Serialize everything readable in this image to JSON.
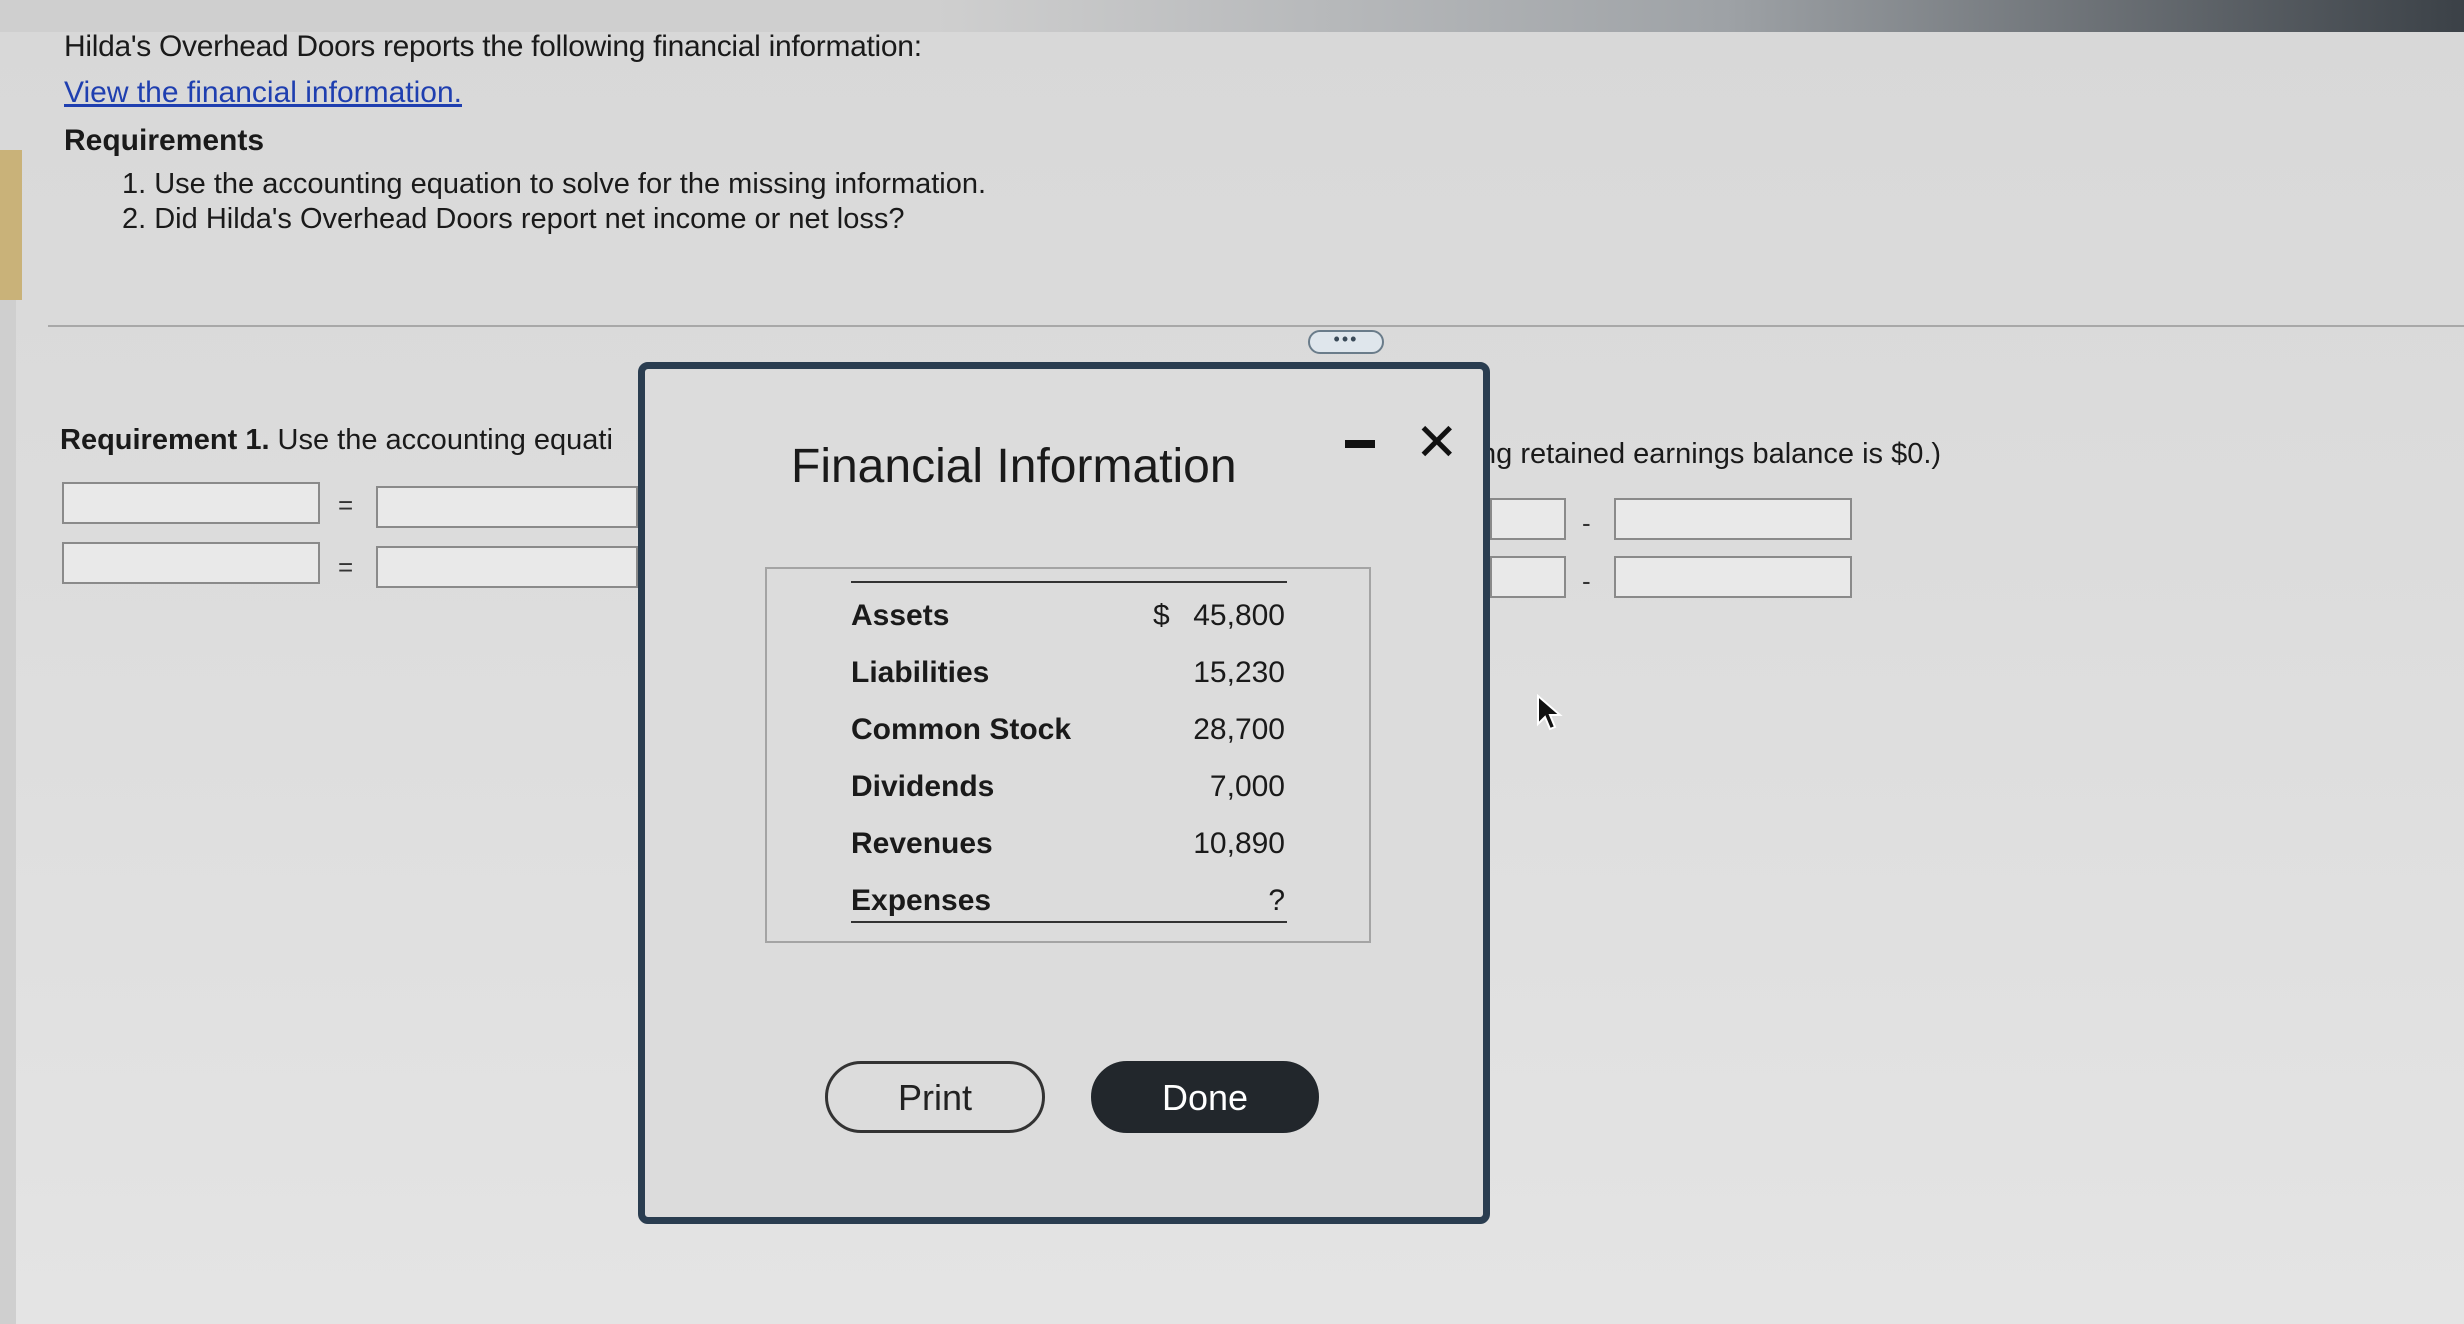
{
  "question": {
    "text": "Hilda's Overhead Doors reports the following financial information:",
    "link": "View the financial information.",
    "requirements_heading": "Requirements",
    "requirements": [
      "1. Use the accounting equation to solve for the missing information.",
      "2. Did Hilda's Overhead Doors report net income or net loss?"
    ]
  },
  "requirement1": {
    "label": "Requirement 1.",
    "text": " Use the accounting equati",
    "tail": "ng retained earnings balance is $0.)",
    "equals": "=",
    "minus": "-"
  },
  "modal": {
    "title": "Financial Information",
    "currency": "$",
    "rows": [
      {
        "label": "Assets",
        "value": "45,800"
      },
      {
        "label": "Liabilities",
        "value": "15,230"
      },
      {
        "label": "Common Stock",
        "value": "28,700"
      },
      {
        "label": "Dividends",
        "value": "7,000"
      },
      {
        "label": "Revenues",
        "value": "10,890"
      },
      {
        "label": "Expenses",
        "value": "?"
      }
    ],
    "print_label": "Print",
    "done_label": "Done"
  },
  "icons": {
    "grip": "grip-handle-icon",
    "minimize": "minimize-icon",
    "close": "close-icon",
    "cursor": "mouse-cursor-icon"
  }
}
